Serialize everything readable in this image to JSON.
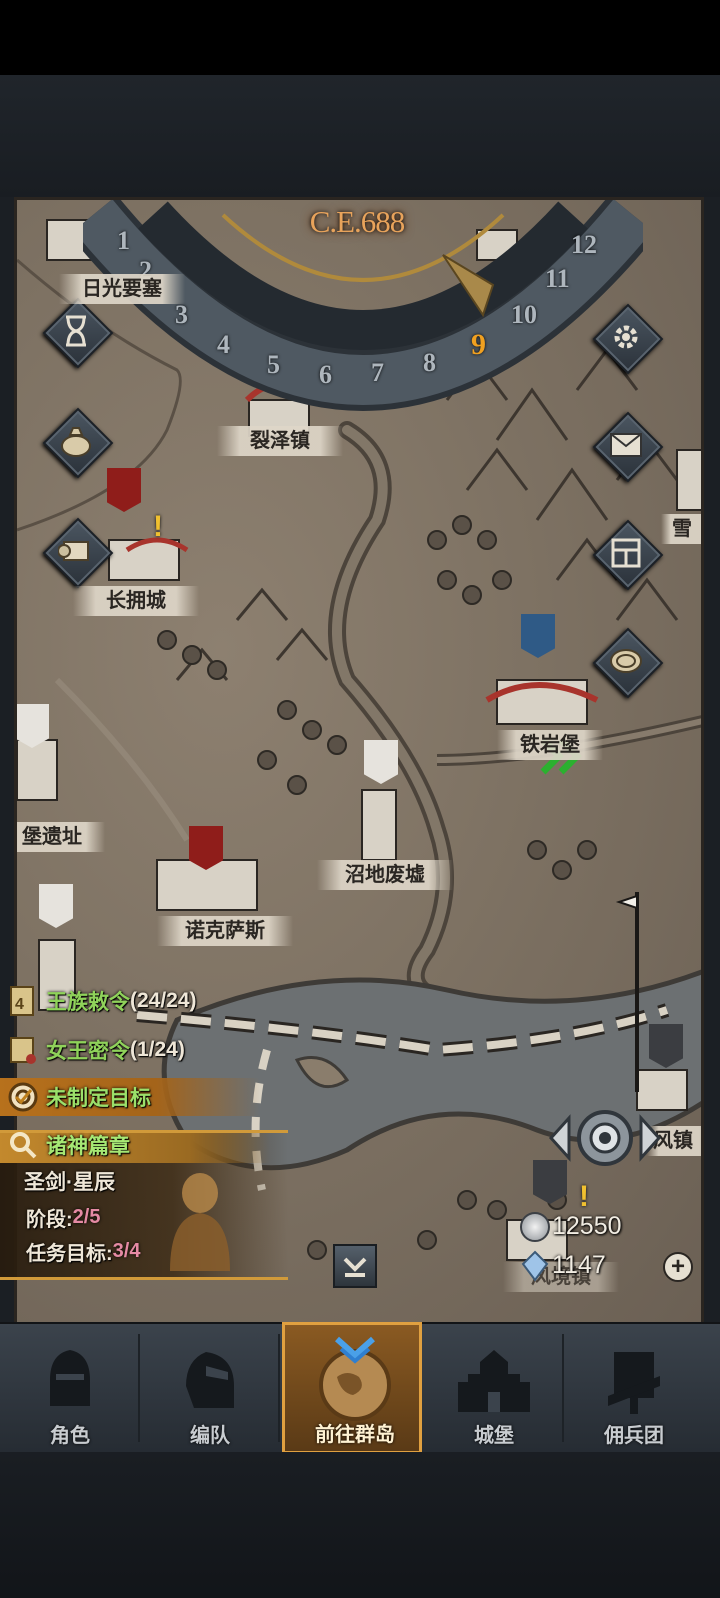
{
  "calendar": {
    "year": "C.E.688",
    "months": [
      "1",
      "2",
      "3",
      "4",
      "5",
      "6",
      "7",
      "8",
      "9",
      "10",
      "11",
      "12"
    ],
    "current_month": "9"
  },
  "map_labels": {
    "sunlight_fort": "日光要塞",
    "liezhe_town": "裂泽镇",
    "changyong_city": "长拥城",
    "tieyan_fort": "铁岩堡",
    "fort_ruins": "堡遗址",
    "swamp_ruins": "沼地废墟",
    "noksas": "诺克萨斯",
    "snow": "雪",
    "feng_town": "风镇",
    "bottom_town": "风境镇"
  },
  "quests": {
    "royal_order": {
      "label": "王族敕令",
      "progress": "(24/24)",
      "badge": "4"
    },
    "queen_order": {
      "label": "女王密令",
      "progress": "(1/24)"
    },
    "goal": "未制定目标",
    "gods_chapter": {
      "title": "诸神篇章",
      "name": "圣剑·星辰",
      "stage_label": "阶段: ",
      "stage_value": "2/5",
      "target_label": "任务目标: ",
      "target_value": "3/4"
    }
  },
  "currency": {
    "silver": "12550",
    "crystal": "1147"
  },
  "side_buttons": {
    "left": [
      "hourglass-icon",
      "money-bag-icon",
      "scroll-icon"
    ],
    "right": [
      "gear-icon",
      "mail-icon",
      "castle-grid-icon",
      "coin-icon"
    ]
  },
  "nav": {
    "tabs": [
      "角色",
      "编队",
      "前往群岛",
      "城堡",
      "佣兵团"
    ],
    "active": "前往群岛"
  },
  "colors": {
    "accent_orange": "#e0a040",
    "quest_green": "#8fd25a",
    "parchment": "#7e7263"
  }
}
